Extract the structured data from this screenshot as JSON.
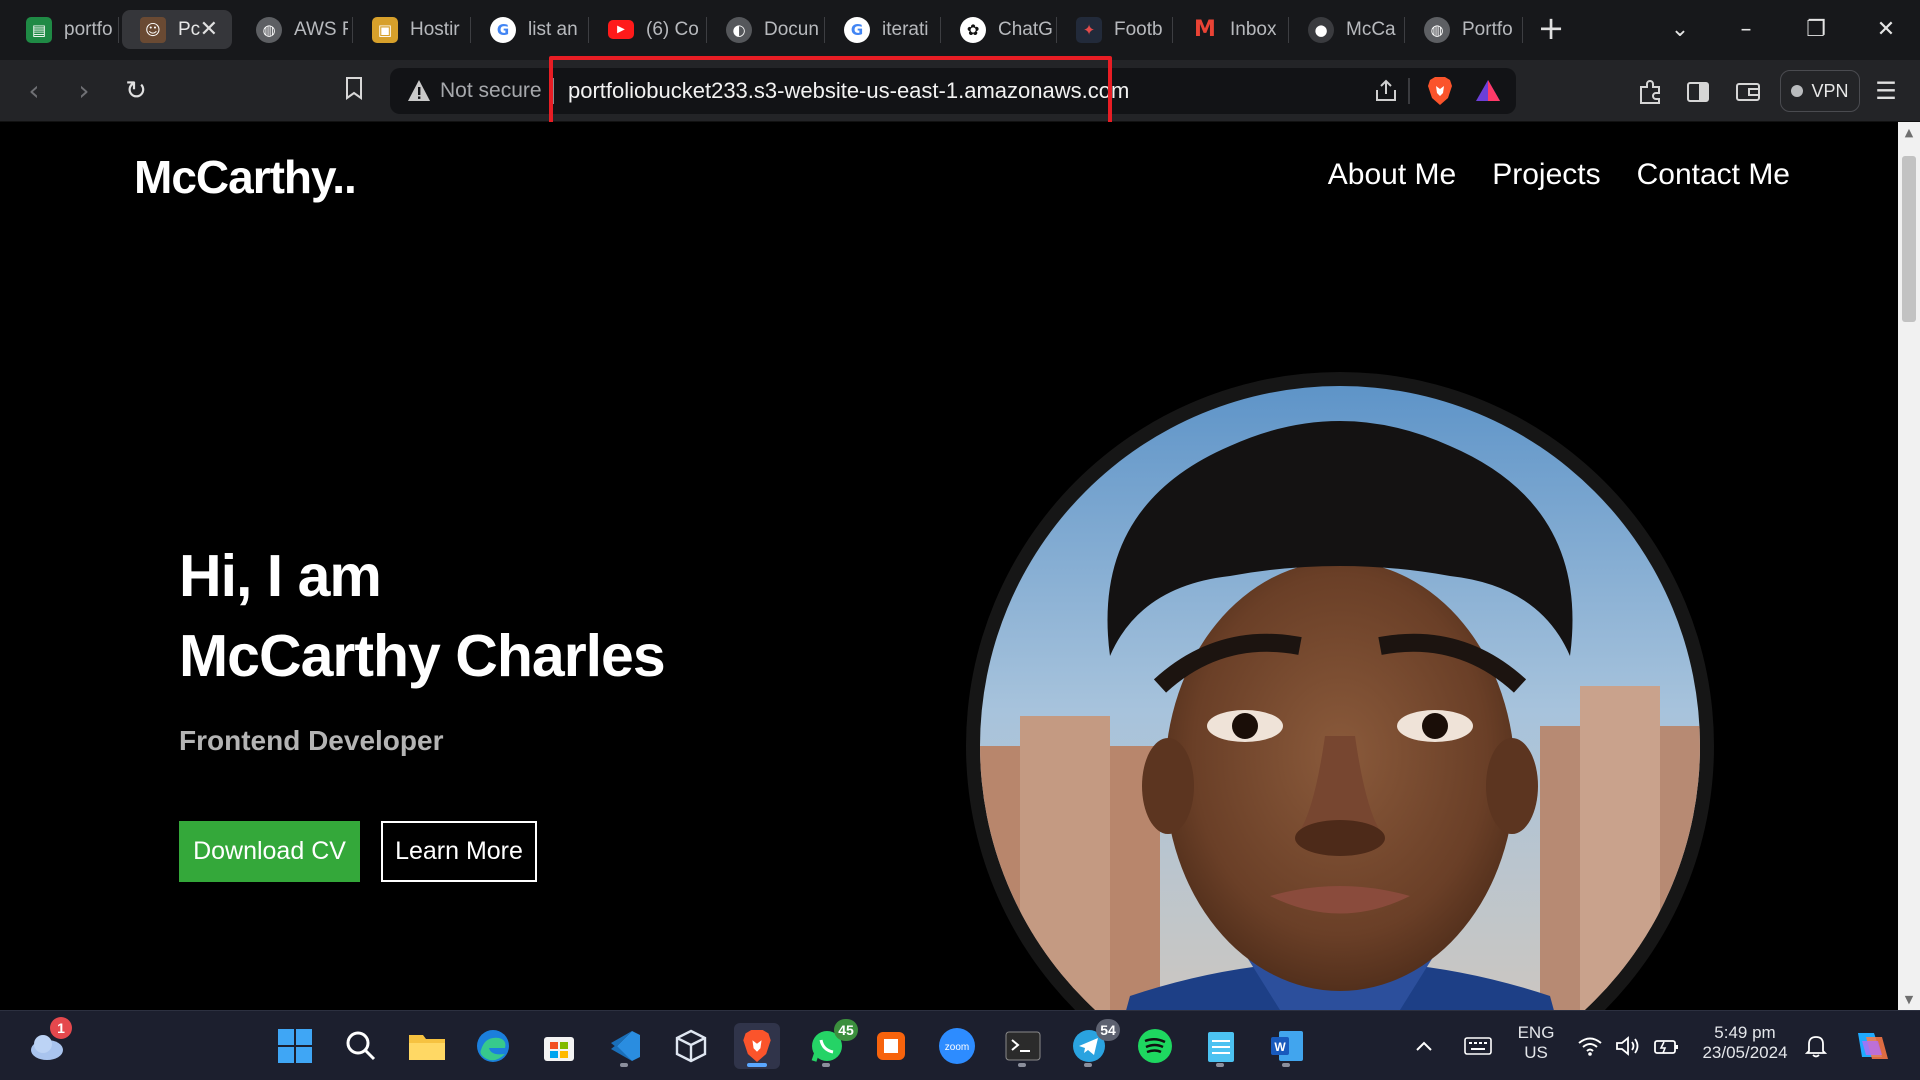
{
  "browser": {
    "tabs": [
      {
        "title": "portfo",
        "icon": "sheets-icon",
        "color": "#1f8a45",
        "active": false
      },
      {
        "title": "Pc",
        "icon": "profile-photo-icon",
        "color": "#6a4a33",
        "active": true,
        "close": "✕"
      },
      {
        "title": "AWS F",
        "icon": "globe-icon",
        "color": "#6a6c70",
        "active": false
      },
      {
        "title": "Hostir",
        "icon": "package-icon",
        "color": "#d7a02b",
        "active": false
      },
      {
        "title": "list an",
        "icon": "google-icon",
        "color": "#ffffff",
        "active": false
      },
      {
        "title": "(6) Co",
        "icon": "youtube-icon",
        "color": "#ff1a1a",
        "active": false
      },
      {
        "title": "Docun",
        "icon": "docs-icon",
        "color": "#6a6c70",
        "active": false
      },
      {
        "title": "iterati",
        "icon": "google-icon",
        "color": "#ffffff",
        "active": false
      },
      {
        "title": "ChatG",
        "icon": "openai-icon",
        "color": "#ffffff",
        "active": false
      },
      {
        "title": "Footb",
        "icon": "football-icon",
        "color": "#222a3a",
        "active": false
      },
      {
        "title": "Inbox",
        "icon": "gmail-icon",
        "color": "#ea4335",
        "active": false
      },
      {
        "title": "McCa",
        "icon": "github-icon",
        "color": "#3a3b3f",
        "active": false
      },
      {
        "title": "Portfo",
        "icon": "globe-icon",
        "color": "#6a6c70",
        "active": false
      }
    ],
    "new_tab": "+",
    "address": {
      "security_label": "Not secure",
      "url": "portfoliobucket233.s3-website-us-east-1.amazonaws.com"
    },
    "vpn_label": "VPN"
  },
  "page": {
    "logo": "McCarthy..",
    "nav": [
      "About Me",
      "Projects",
      "Contact Me"
    ],
    "hero": {
      "line1": "Hi, I am",
      "line2": "McCarthy Charles",
      "role": "Frontend Developer",
      "primary_button": "Download CV",
      "secondary_button": "Learn More"
    },
    "accent_color": "#34a83a"
  },
  "taskbar": {
    "weather_badge": "1",
    "apps": [
      {
        "name": "start-icon"
      },
      {
        "name": "search-icon"
      },
      {
        "name": "file-explorer-icon"
      },
      {
        "name": "edge-icon"
      },
      {
        "name": "microsoft-store-icon"
      },
      {
        "name": "vscode-icon"
      },
      {
        "name": "virtualbox-icon"
      },
      {
        "name": "brave-icon"
      },
      {
        "name": "whatsapp-icon",
        "badge": "45"
      },
      {
        "name": "office-icon"
      },
      {
        "name": "zoom-icon",
        "label": "zoom"
      },
      {
        "name": "terminal-icon"
      },
      {
        "name": "telegram-icon",
        "badge": "54"
      },
      {
        "name": "spotify-icon"
      },
      {
        "name": "notepad-icon"
      },
      {
        "name": "word-icon",
        "label": "W"
      }
    ],
    "tray": {
      "lang_top": "ENG",
      "lang_bottom": "US",
      "time": "5:49 pm",
      "date": "23/05/2024"
    }
  }
}
